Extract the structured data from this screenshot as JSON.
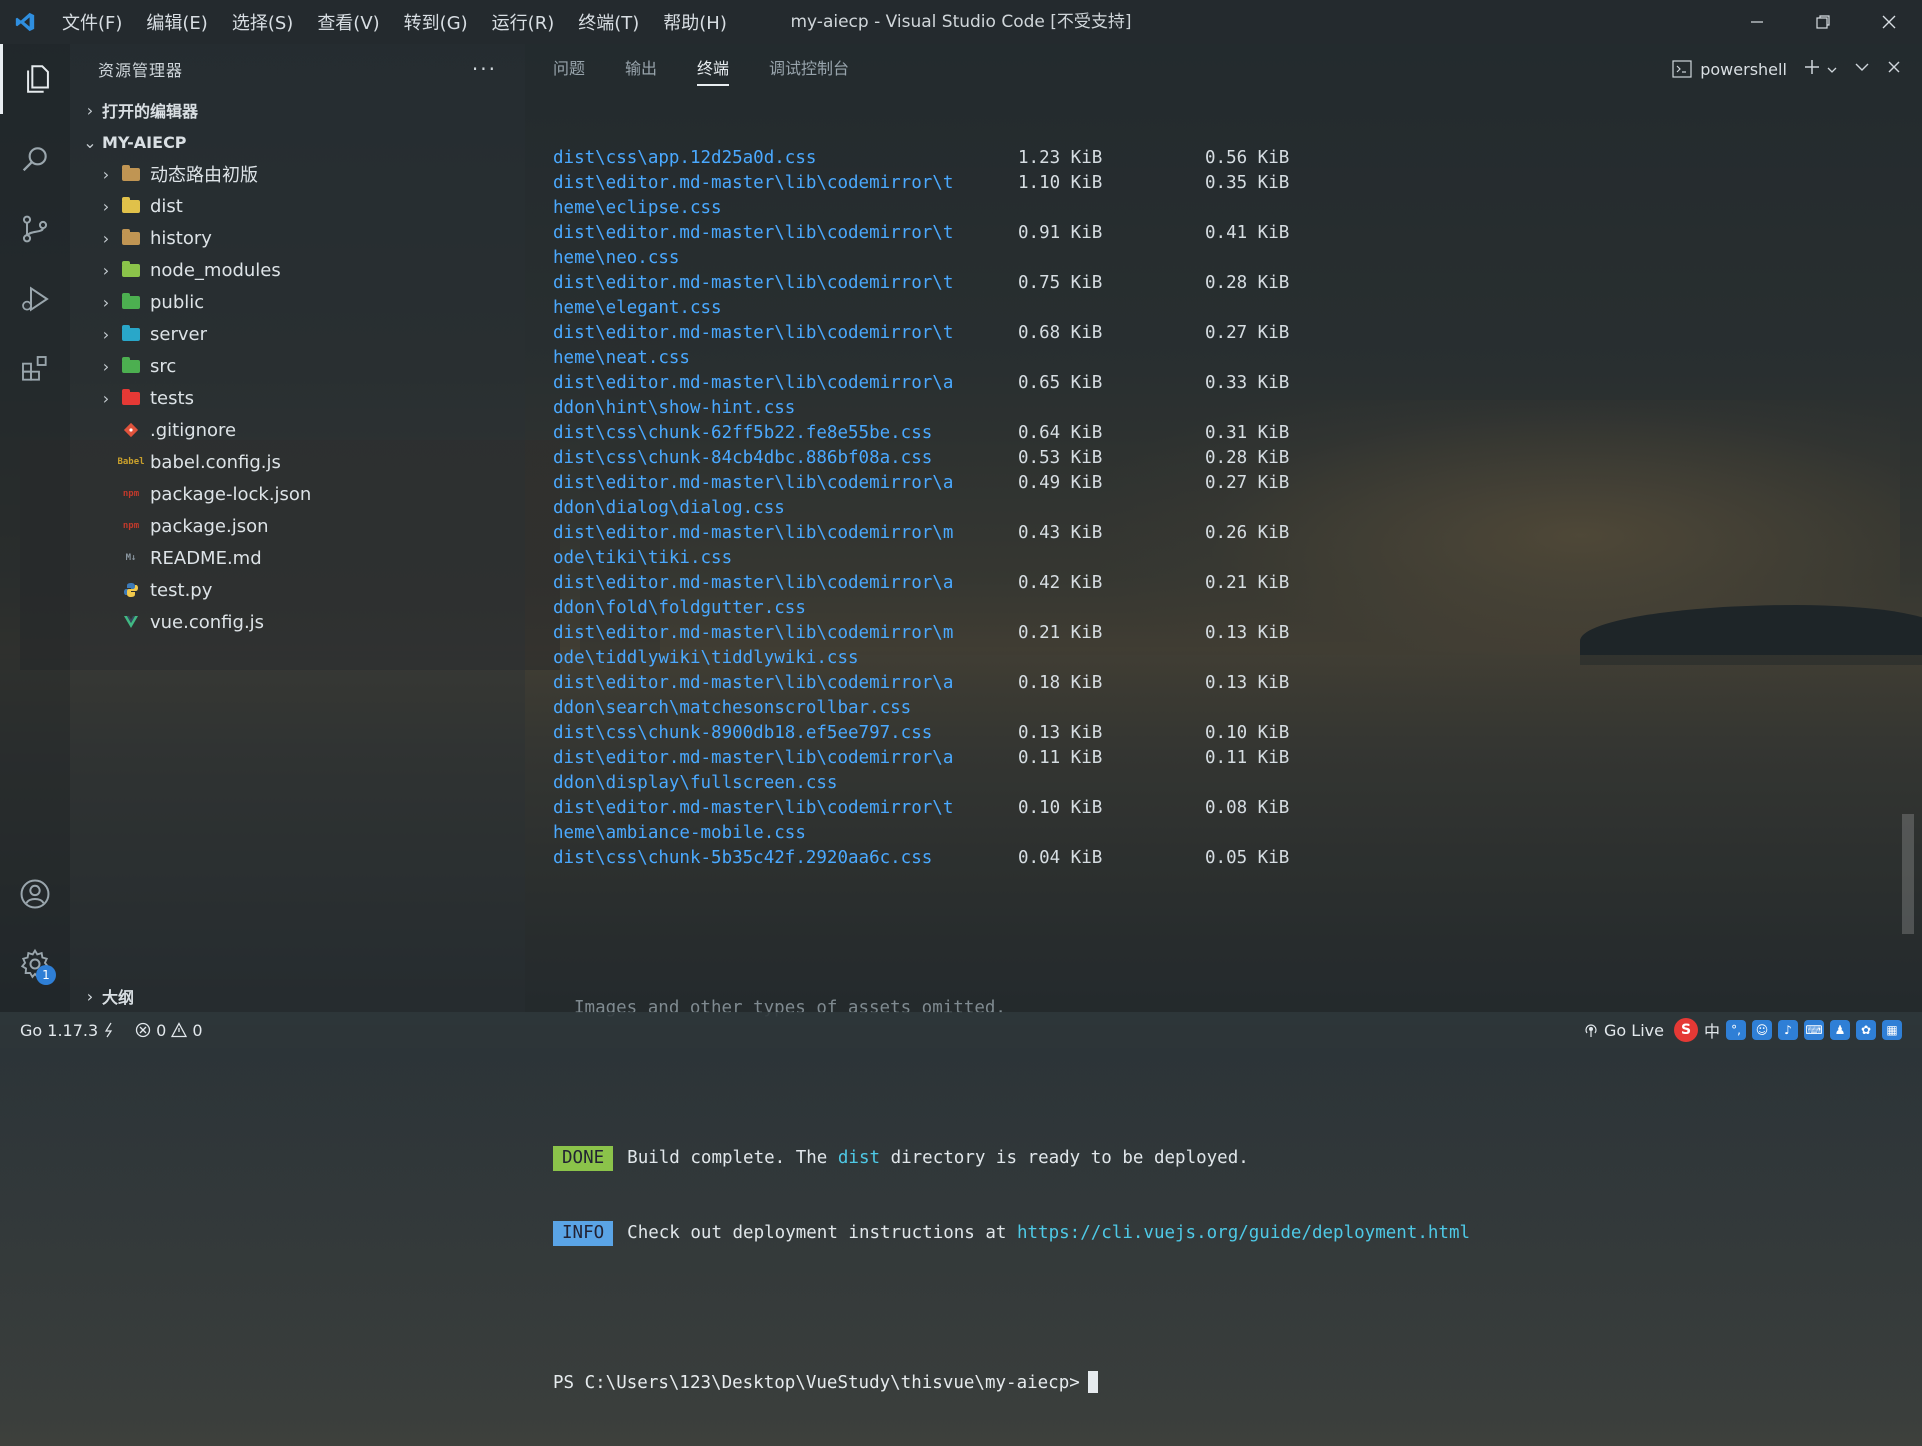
{
  "window": {
    "title": "my-aiecp - Visual Studio Code [不受支持]"
  },
  "menu": [
    "文件(F)",
    "编辑(E)",
    "选择(S)",
    "查看(V)",
    "转到(G)",
    "运行(R)",
    "终端(T)",
    "帮助(H)"
  ],
  "sidebar": {
    "title": "资源管理器",
    "more": "···",
    "open_editors": "打开的编辑器",
    "project": "MY-AIECP",
    "tree": [
      {
        "name": "动态路由初版",
        "kind": "folder",
        "color": "#c09553"
      },
      {
        "name": "dist",
        "kind": "folder",
        "color": "#e0c14a"
      },
      {
        "name": "history",
        "kind": "folder",
        "color": "#c09553"
      },
      {
        "name": "node_modules",
        "kind": "folder",
        "color": "#8bc34a"
      },
      {
        "name": "public",
        "kind": "folder",
        "color": "#4caf50"
      },
      {
        "name": "server",
        "kind": "folder",
        "color": "#29a7c9"
      },
      {
        "name": "src",
        "kind": "folder",
        "color": "#4caf50"
      },
      {
        "name": "tests",
        "kind": "folder",
        "color": "#e53935"
      },
      {
        "name": ".gitignore",
        "kind": "file",
        "icon": "git-icon",
        "color": "#e0533c"
      },
      {
        "name": "babel.config.js",
        "kind": "file",
        "icon": "babel-icon",
        "color": "#c9a02c",
        "tag": "Babel"
      },
      {
        "name": "package-lock.json",
        "kind": "file",
        "icon": "npm-icon",
        "color": "#c0392b",
        "tag": "npm"
      },
      {
        "name": "package.json",
        "kind": "file",
        "icon": "npm-icon",
        "color": "#c0392b",
        "tag": "npm"
      },
      {
        "name": "README.md",
        "kind": "file",
        "icon": "markdown-icon",
        "color": "#8a96a0",
        "tag": "M↓"
      },
      {
        "name": "test.py",
        "kind": "file",
        "icon": "python-icon",
        "color": "#3d7ab8"
      },
      {
        "name": "vue.config.js",
        "kind": "file",
        "icon": "vue-icon",
        "color": "#41b883"
      }
    ],
    "outline": "大纲"
  },
  "panel": {
    "tabs": [
      "问题",
      "输出",
      "终端",
      "调试控制台"
    ],
    "active_tab": "终端",
    "shell": "powershell"
  },
  "terminal": {
    "rows": [
      {
        "name": "dist\\css\\app.12d25a0d.css",
        "size": "1.23 KiB",
        "gzip": "0.56 KiB"
      },
      {
        "name": "dist\\editor.md-master\\lib\\codemirror\\t",
        "size": "1.10 KiB",
        "gzip": "0.35 KiB"
      },
      {
        "name": "heme\\eclipse.css",
        "size": "",
        "gzip": ""
      },
      {
        "name": "dist\\editor.md-master\\lib\\codemirror\\t",
        "size": "0.91 KiB",
        "gzip": "0.41 KiB"
      },
      {
        "name": "heme\\neo.css",
        "size": "",
        "gzip": ""
      },
      {
        "name": "dist\\editor.md-master\\lib\\codemirror\\t",
        "size": "0.75 KiB",
        "gzip": "0.28 KiB"
      },
      {
        "name": "heme\\elegant.css",
        "size": "",
        "gzip": ""
      },
      {
        "name": "dist\\editor.md-master\\lib\\codemirror\\t",
        "size": "0.68 KiB",
        "gzip": "0.27 KiB"
      },
      {
        "name": "heme\\neat.css",
        "size": "",
        "gzip": ""
      },
      {
        "name": "dist\\editor.md-master\\lib\\codemirror\\a",
        "size": "0.65 KiB",
        "gzip": "0.33 KiB"
      },
      {
        "name": "ddon\\hint\\show-hint.css",
        "size": "",
        "gzip": ""
      },
      {
        "name": "dist\\css\\chunk-62ff5b22.fe8e55be.css",
        "size": "0.64 KiB",
        "gzip": "0.31 KiB"
      },
      {
        "name": "dist\\css\\chunk-84cb4dbc.886bf08a.css",
        "size": "0.53 KiB",
        "gzip": "0.28 KiB"
      },
      {
        "name": "dist\\editor.md-master\\lib\\codemirror\\a",
        "size": "0.49 KiB",
        "gzip": "0.27 KiB"
      },
      {
        "name": "ddon\\dialog\\dialog.css",
        "size": "",
        "gzip": ""
      },
      {
        "name": "dist\\editor.md-master\\lib\\codemirror\\m",
        "size": "0.43 KiB",
        "gzip": "0.26 KiB"
      },
      {
        "name": "ode\\tiki\\tiki.css",
        "size": "",
        "gzip": ""
      },
      {
        "name": "dist\\editor.md-master\\lib\\codemirror\\a",
        "size": "0.42 KiB",
        "gzip": "0.21 KiB"
      },
      {
        "name": "ddon\\fold\\foldgutter.css",
        "size": "",
        "gzip": ""
      },
      {
        "name": "dist\\editor.md-master\\lib\\codemirror\\m",
        "size": "0.21 KiB",
        "gzip": "0.13 KiB"
      },
      {
        "name": "ode\\tiddlywiki\\tiddlywiki.css",
        "size": "",
        "gzip": ""
      },
      {
        "name": "dist\\editor.md-master\\lib\\codemirror\\a",
        "size": "0.18 KiB",
        "gzip": "0.13 KiB"
      },
      {
        "name": "ddon\\search\\matchesonscrollbar.css",
        "size": "",
        "gzip": ""
      },
      {
        "name": "dist\\css\\chunk-8900db18.ef5ee797.css",
        "size": "0.13 KiB",
        "gzip": "0.10 KiB"
      },
      {
        "name": "dist\\editor.md-master\\lib\\codemirror\\a",
        "size": "0.11 KiB",
        "gzip": "0.11 KiB"
      },
      {
        "name": "ddon\\display\\fullscreen.css",
        "size": "",
        "gzip": ""
      },
      {
        "name": "dist\\editor.md-master\\lib\\codemirror\\t",
        "size": "0.10 KiB",
        "gzip": "0.08 KiB"
      },
      {
        "name": "heme\\ambiance-mobile.css",
        "size": "",
        "gzip": ""
      },
      {
        "name": "dist\\css\\chunk-5b35c42f.2920aa6c.css",
        "size": "0.04 KiB",
        "gzip": "0.05 KiB"
      }
    ],
    "omitted": "Images and other types of assets omitted.",
    "done_tag": "DONE",
    "done_pre": "Build complete. The ",
    "done_hl": "dist",
    "done_post": " directory is ready to be deployed.",
    "info_tag": "INFO",
    "info_pre": "Check out deployment instructions at ",
    "info_link": "https://cli.vuejs.org/guide/deployment.html",
    "prompt": "PS C:\\Users\\123\\Desktop\\VueStudy\\thisvue\\my-aiecp>"
  },
  "statusbar": {
    "go_version": "Go 1.17.3",
    "errors": "0",
    "warnings": "0",
    "go_live": "Go Live",
    "ime_lang": "中",
    "settings_badge": "1"
  }
}
